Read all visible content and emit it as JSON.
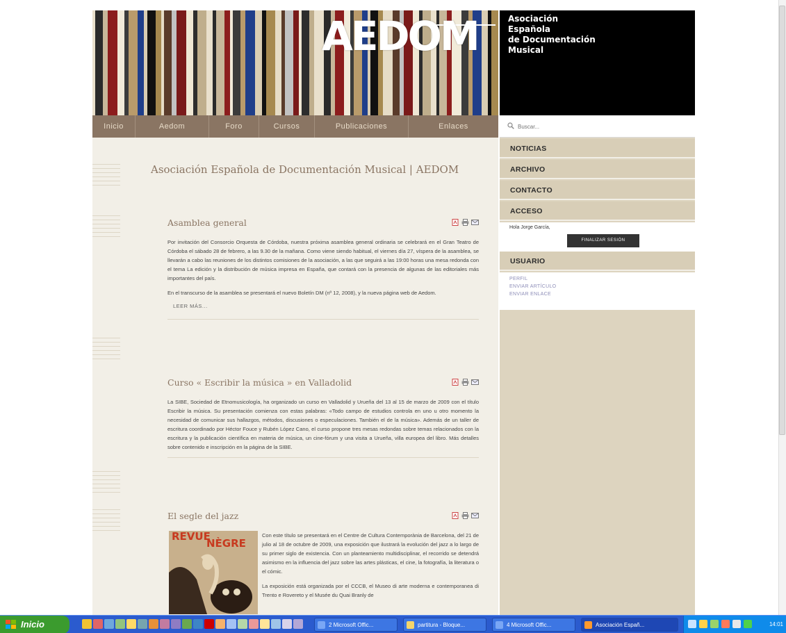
{
  "site": {
    "logo_text": "AEDOM",
    "org_lines": [
      "Asociación",
      "Española",
      "de Documentación",
      "Musical"
    ]
  },
  "nav": {
    "items": [
      "Inicio",
      "Aedom",
      "Foro",
      "Cursos",
      "Publicaciones",
      "Enlaces"
    ]
  },
  "search": {
    "placeholder": "Buscar..."
  },
  "main": {
    "page_title": "Asociación Española de Documentación Musical | AEDOM",
    "articles": [
      {
        "title": "Asamblea general",
        "paragraphs": [
          "Por invitación del Consorcio Orquesta de Córdoba, nuestra próxima asamblea general ordinaria se celebrará en el Gran Teatro de Córdoba el sábado 28 de febrero, a las 9.30 de la mañana. Como viene siendo habitual, el viernes día 27, víspera de la asamblea, se llevarán a cabo las reuniones de los distintos comisiones de la asociación, a las que seguirá a las 19:00 horas una mesa redonda con el tema La edición y la distribución de música impresa en España, que contará con la presencia de algunas de las editoriales más importantes del país.",
          "En el transcurso de la asamblea se presentará el nuevo Boletín DM (nº 12, 2008), y la nueva página web de Aedom."
        ],
        "readmore": "LEER MÁS..."
      },
      {
        "title": "Curso « Escribir la música » en Valladolid",
        "paragraphs": [
          "La SIBE, Sociedad de Etnomusicología, ha organizado un curso en Valladolid y Urueña del 13 al 15 de marzo de 2009 con el título Escribir la música. Su presentación comienza con estas palabras: «Todo campo de estudios controla en uno u otro momento la necesidad de comunicar sus hallazgos, métodos, discusiones o especulaciones. También el de la música». Además de un taller de escritura coordinado por Héctor Fouce y Rubén López Cano, el curso propone tres mesas redondas sobre temas relacionados con la escritura y la publicación científica en materia de música, un cine-fórum y una visita a Urueña, villa europea del libro. Más detalles sobre contenido e inscripción en la página de la SIBE."
        ],
        "link_text": "SIBE"
      },
      {
        "title": "El segle del jazz",
        "poster_text": [
          "REVUE",
          "NÈGRE"
        ],
        "paragraphs": [
          "Con este título se presentará en el Centre de Cultura Contemporània de Barcelona, del 21 de julio al 18 de octubre de 2009, una exposición que ilustrará la evolución del jazz a lo largo de su primer siglo de existencia. Con un planteamiento multidisciplinar, el recorrido se detendrá asimismo en la influencia del jazz sobre las artes plásticas, el cine, la fotografía, la literatura o el cómic.",
          "La exposición está organizada por el CCCB, el Museo di arte moderna e contemporanea di Trento e Rovereto y el Musée du Quai Branly de"
        ]
      }
    ]
  },
  "sidebar": {
    "menu": [
      "NOTICIAS",
      "ARCHIVO",
      "CONTACTO"
    ],
    "acceso": {
      "heading": "ACCESO",
      "greeting": "Hola Jorge García,",
      "logout_label": "FINALIZAR SESIÓN"
    },
    "usuario": {
      "heading": "USUARIO",
      "links": [
        "PERFIL",
        "ENVIAR ARTÍCULO",
        "ENVIAR ENLACE"
      ]
    }
  },
  "taskbar": {
    "start_label": "Inicio",
    "tasks": [
      "2 Microsoft Offic...",
      "partitura - Bloque...",
      "4 Microsoft Offic...",
      "Asociación Españ..."
    ],
    "clock": "14:01"
  }
}
